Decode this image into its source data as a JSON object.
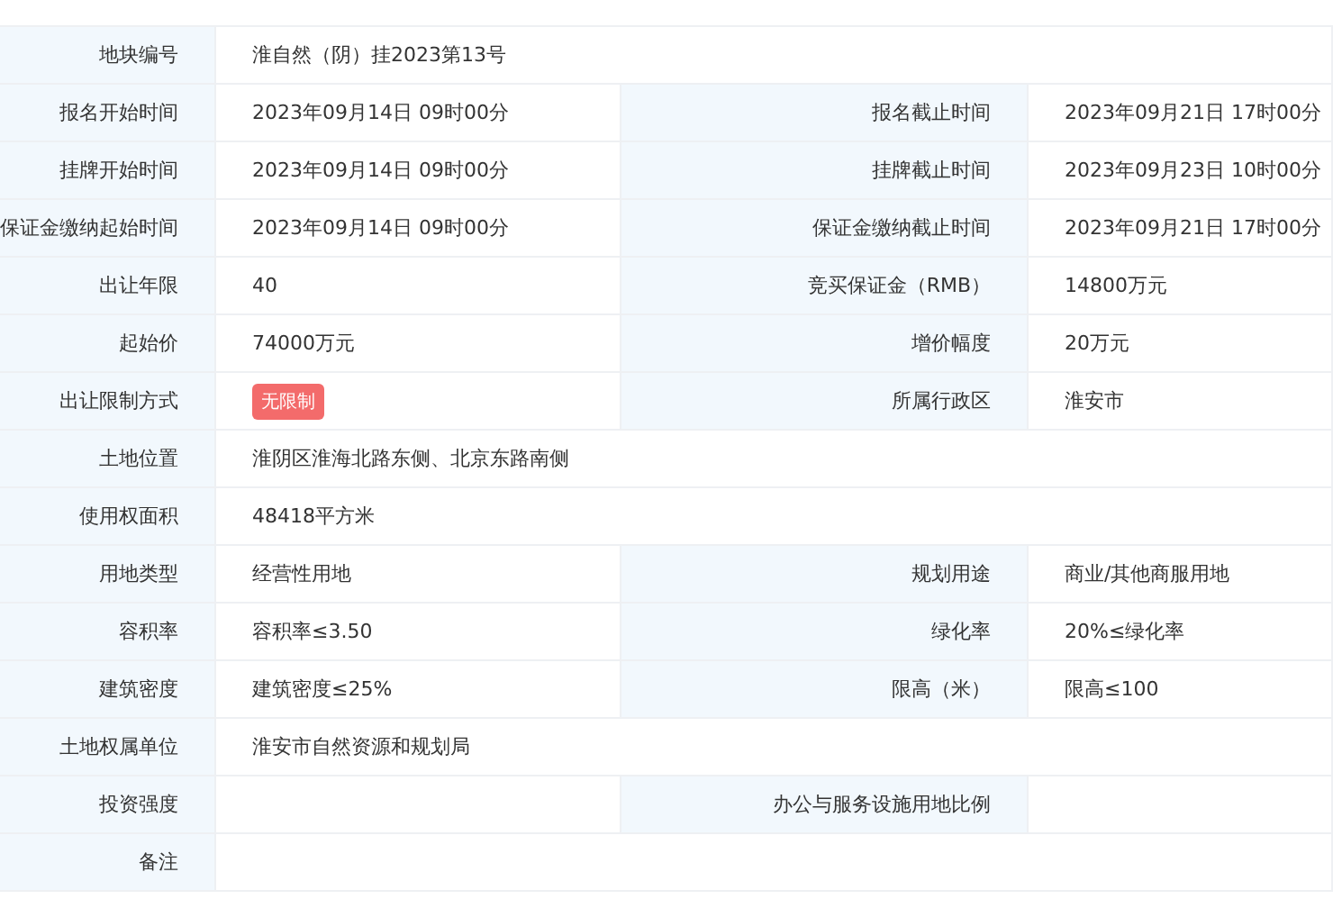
{
  "rows": [
    {
      "fields": [
        {
          "label": "地块编号",
          "value": "淮自然（阴）挂2023第13号"
        }
      ]
    },
    {
      "fields": [
        {
          "label": "报名开始时间",
          "value": "2023年09月14日 09时00分"
        },
        {
          "label": "报名截止时间",
          "value": "2023年09月21日 17时00分"
        }
      ]
    },
    {
      "fields": [
        {
          "label": "挂牌开始时间",
          "value": "2023年09月14日 09时00分"
        },
        {
          "label": "挂牌截止时间",
          "value": "2023年09月23日 10时00分"
        }
      ]
    },
    {
      "fields": [
        {
          "label": "保证金缴纳起始时间",
          "value": "2023年09月14日 09时00分"
        },
        {
          "label": "保证金缴纳截止时间",
          "value": "2023年09月21日 17时00分"
        }
      ]
    },
    {
      "fields": [
        {
          "label": "出让年限",
          "value": "40"
        },
        {
          "label": "竞买保证金（RMB）",
          "value": "14800万元"
        }
      ]
    },
    {
      "fields": [
        {
          "label": "起始价",
          "value": "74000万元"
        },
        {
          "label": "增价幅度",
          "value": "20万元"
        }
      ]
    },
    {
      "fields": [
        {
          "label": "出让限制方式",
          "value": "无限制",
          "kind": "tag"
        },
        {
          "label": "所属行政区",
          "value": "淮安市"
        }
      ]
    },
    {
      "fields": [
        {
          "label": "土地位置",
          "value": "淮阴区淮海北路东侧、北京东路南侧"
        }
      ]
    },
    {
      "fields": [
        {
          "label": "使用权面积",
          "value": "48418平方米"
        }
      ]
    },
    {
      "fields": [
        {
          "label": "用地类型",
          "value": "经营性用地"
        },
        {
          "label": "规划用途",
          "value": "商业/其他商服用地"
        }
      ]
    },
    {
      "fields": [
        {
          "label": "容积率",
          "value": "容积率≤3.50"
        },
        {
          "label": "绿化率",
          "value": "20%≤绿化率"
        }
      ]
    },
    {
      "fields": [
        {
          "label": "建筑密度",
          "value": "建筑密度≤25%"
        },
        {
          "label": "限高（米）",
          "value": "限高≤100"
        }
      ]
    },
    {
      "fields": [
        {
          "label": "土地权属单位",
          "value": "淮安市自然资源和规划局"
        }
      ]
    },
    {
      "fields": [
        {
          "label": "投资强度"
        },
        {
          "label": "办公与服务设施用地比例"
        }
      ]
    },
    {
      "fields": [
        {
          "label": "备注"
        }
      ]
    }
  ]
}
